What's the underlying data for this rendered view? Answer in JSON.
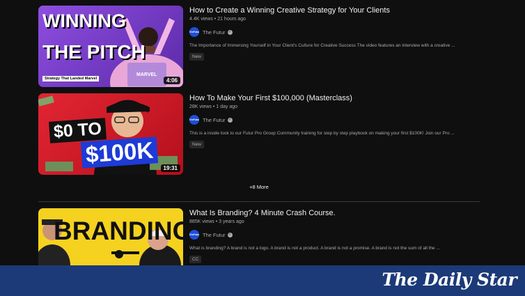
{
  "videos": [
    {
      "title": "How to Create a Winning Creative Strategy for Your Clients",
      "views": "4.4K views",
      "age": "21 hours ago",
      "channel": "The Futur",
      "description": "The Importance of Immersing Yourself in Your Client's Culture for Creative Success The video features an interview with a creative ...",
      "badge": "New",
      "duration": "4:06",
      "thumb_text_1": "WINNING",
      "thumb_text_2": "THE PITCH",
      "thumb_caption": "Strategy That Landed Marvel",
      "thumb_logo": "MARVEL"
    },
    {
      "title": "How To Make Your First $100,000 (Masterclass)",
      "views": "28K views",
      "age": "1 day ago",
      "channel": "The Futur",
      "description": "This is a inside look to our Futur Pro Group Community training for step by step playbook on making your first $100K! Join our Pro ...",
      "badge": "New",
      "duration": "19:31",
      "thumb_text_1": "$0 TO",
      "thumb_text_2": "$100K"
    },
    {
      "title": "What Is Branding? 4 Minute Crash Course.",
      "views": "885K views",
      "age": "3 years ago",
      "channel": "The Futur",
      "description": "What is branding? A brand is not a logo. A brand is not a product. A brand is not a promise. A brand is not the sum of all the ...",
      "badge": "CC",
      "thumb_text_1": "BRANDING"
    }
  ],
  "more_label": "+8 More",
  "avatar_text": "TheFutur",
  "watermark": "The Daily Star",
  "colors": {
    "background": "#0f0f0f",
    "bottom_bar": "#1c3a78",
    "thumb1_bg": "#7b3fc9",
    "thumb2_bg": "#d81b2c",
    "thumb3_bg": "#f5d21f"
  }
}
